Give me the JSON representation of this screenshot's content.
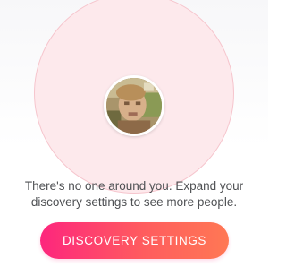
{
  "discovery": {
    "empty_message": "There's no one around you. Expand your discovery settings to see more people.",
    "settings_button_label": "DISCOVERY SETTINGS",
    "profile_photo": "blurred-profile-photo"
  },
  "theme": {
    "accent_start": "#fd267d",
    "accent_end": "#ff7854",
    "pulse_fill": "#fde9ec",
    "text_color": "#4f5154"
  }
}
